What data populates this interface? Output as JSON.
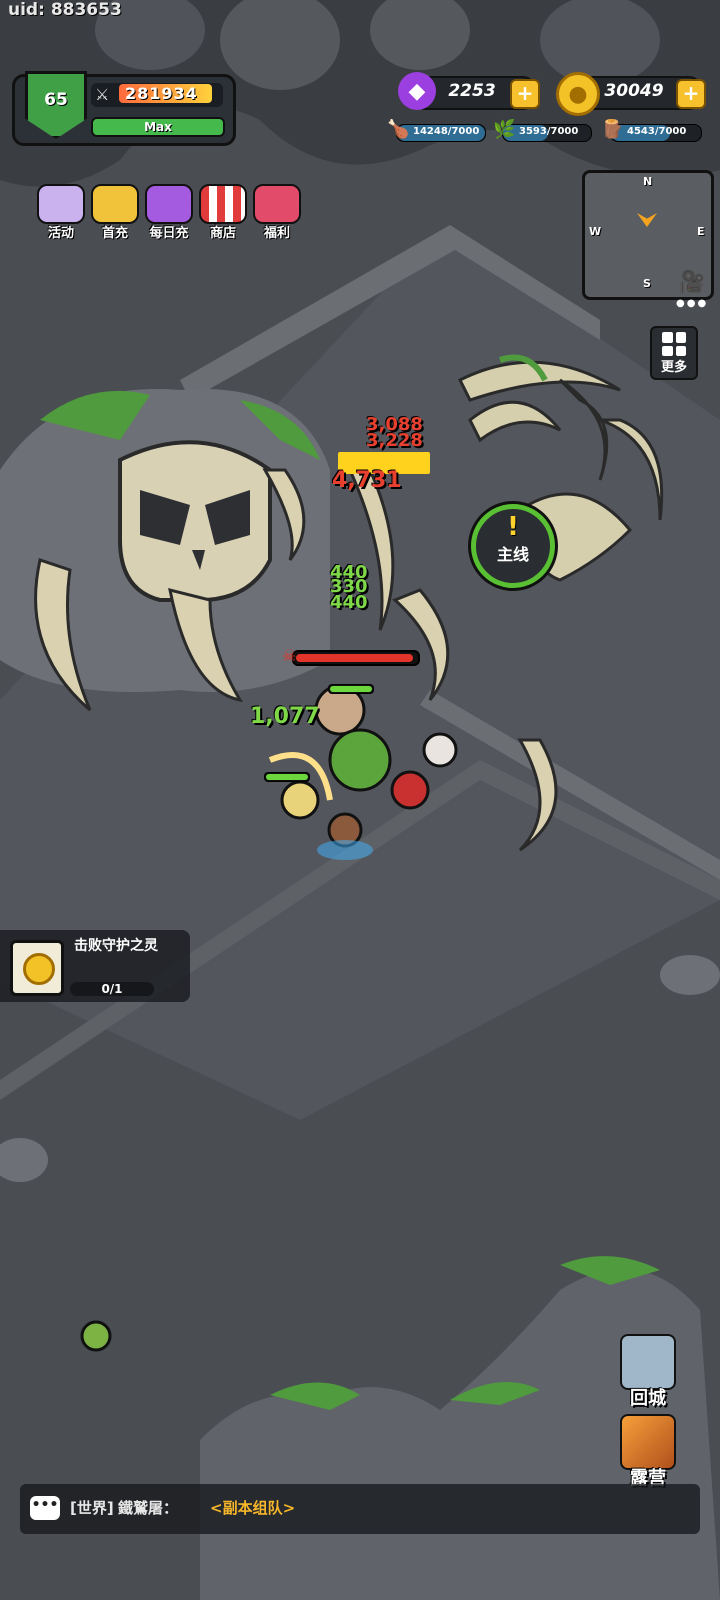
{
  "uid": "uid: 883653",
  "player": {
    "level": "65",
    "power": "281934",
    "xp_label": "Max"
  },
  "currencies": {
    "gems": {
      "value": "2253",
      "icon": "gem-icon",
      "color": "#9b3fe0"
    },
    "gold": {
      "value": "30049",
      "icon": "gold-coin-icon",
      "color": "#f3c227"
    }
  },
  "resources": [
    {
      "icon": "meat-icon",
      "value": "14248/7000"
    },
    {
      "icon": "herb-icon",
      "value": "3593/7000"
    },
    {
      "icon": "wood-icon",
      "value": "4543/7000"
    }
  ],
  "activities": [
    {
      "icon": "activity-icon",
      "label": "活动"
    },
    {
      "icon": "first-recharge-icon",
      "label": "首充"
    },
    {
      "icon": "daily-recharge-icon",
      "label": "每日充"
    },
    {
      "icon": "shop-icon",
      "label": "商店"
    },
    {
      "icon": "welfare-gift-icon",
      "label": "福利"
    }
  ],
  "minimap": {
    "n": "N",
    "s": "S",
    "w": "W",
    "e": "E"
  },
  "more_label": "更多",
  "main_quest": {
    "mark": "!",
    "label": "主线"
  },
  "combat": {
    "red_numbers": [
      "3,088",
      "3,228",
      "4,731"
    ],
    "green_numbers": [
      "440",
      "330",
      "440",
      "1,077"
    ]
  },
  "quest_tracker": {
    "text": "击败守护之灵",
    "progress": "0/1"
  },
  "side_buttons": {
    "town": "回城",
    "camp": "露营"
  },
  "chat": {
    "channel": "[世界]",
    "user": "鐵鷲屠：",
    "message": "<副本组队>"
  }
}
